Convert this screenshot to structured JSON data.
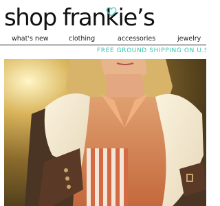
{
  "header": {
    "logo_text": "shop frankie’s",
    "heart_color": "#5ccfc0"
  },
  "nav": {
    "items": [
      {
        "label": "what's new"
      },
      {
        "label": "clothing"
      },
      {
        "label": "accessories"
      },
      {
        "label": "jewelry"
      }
    ]
  },
  "promo": {
    "text": "FREE GROUND SHIPPING ON U.S. ORDERS",
    "color": "#39c2ae"
  },
  "hero": {
    "alt": "model in shearling jacket"
  }
}
